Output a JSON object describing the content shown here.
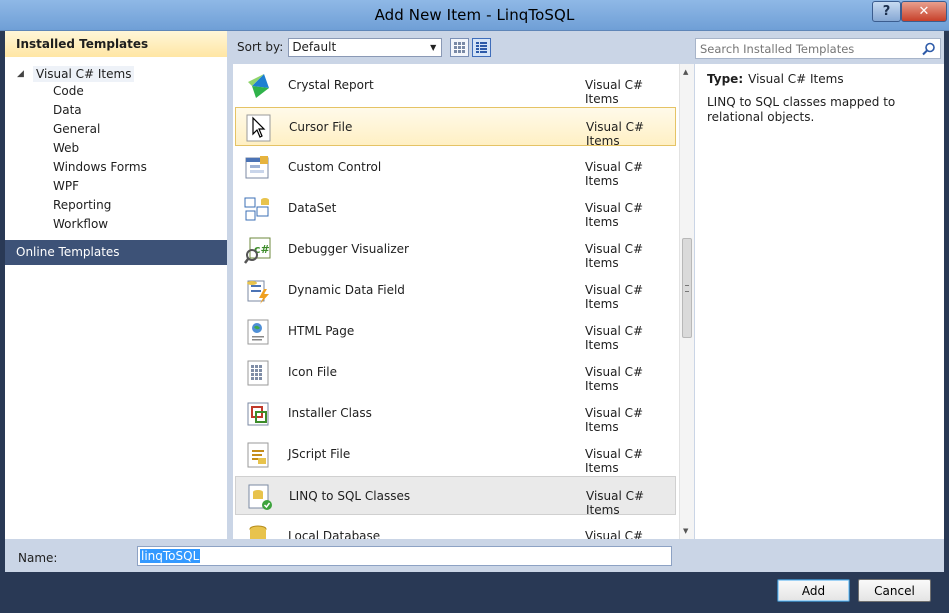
{
  "window": {
    "title": "Add New Item - LinqToSQL",
    "help_label": "?",
    "close_label": "✕"
  },
  "left_panel": {
    "installed_header": "Installed Templates",
    "root_label": "Visual C# Items",
    "children": [
      "Code",
      "Data",
      "General",
      "Web",
      "Windows Forms",
      "WPF",
      "Reporting",
      "Workflow"
    ],
    "online_label": "Online Templates"
  },
  "toolbar": {
    "sort_label": "Sort by:",
    "sort_value": "Default"
  },
  "search": {
    "placeholder": "Search Installed Templates"
  },
  "templates": [
    {
      "name": "Crystal Report",
      "category": "Visual C# Items",
      "icon": "crystal-report-icon"
    },
    {
      "name": "Cursor File",
      "category": "Visual C# Items",
      "icon": "cursor-file-icon"
    },
    {
      "name": "Custom Control",
      "category": "Visual C# Items",
      "icon": "custom-control-icon"
    },
    {
      "name": "DataSet",
      "category": "Visual C# Items",
      "icon": "dataset-icon"
    },
    {
      "name": "Debugger Visualizer",
      "category": "Visual C# Items",
      "icon": "debugger-visualizer-icon"
    },
    {
      "name": "Dynamic Data Field",
      "category": "Visual C# Items",
      "icon": "dynamic-data-field-icon"
    },
    {
      "name": "HTML Page",
      "category": "Visual C# Items",
      "icon": "html-page-icon"
    },
    {
      "name": "Icon File",
      "category": "Visual C# Items",
      "icon": "icon-file-icon"
    },
    {
      "name": "Installer Class",
      "category": "Visual C# Items",
      "icon": "installer-class-icon"
    },
    {
      "name": "JScript File",
      "category": "Visual C# Items",
      "icon": "jscript-file-icon"
    },
    {
      "name": "LINQ to SQL Classes",
      "category": "Visual C# Items",
      "icon": "linq-to-sql-icon"
    },
    {
      "name": "Local Database",
      "category": "Visual C# Items",
      "icon": "local-database-icon"
    }
  ],
  "details": {
    "type_label": "Type:",
    "type_value": "Visual C# Items",
    "description": "LINQ to SQL classes mapped to relational objects."
  },
  "name_field": {
    "label": "Name:",
    "value": "linqToSQL"
  },
  "buttons": {
    "add": "Add",
    "cancel": "Cancel"
  },
  "colors": {
    "frame_dark": "#293955",
    "panel_bg": "#cad5e6",
    "hover_border": "#e5c365",
    "selection_blue": "#3399ff"
  }
}
